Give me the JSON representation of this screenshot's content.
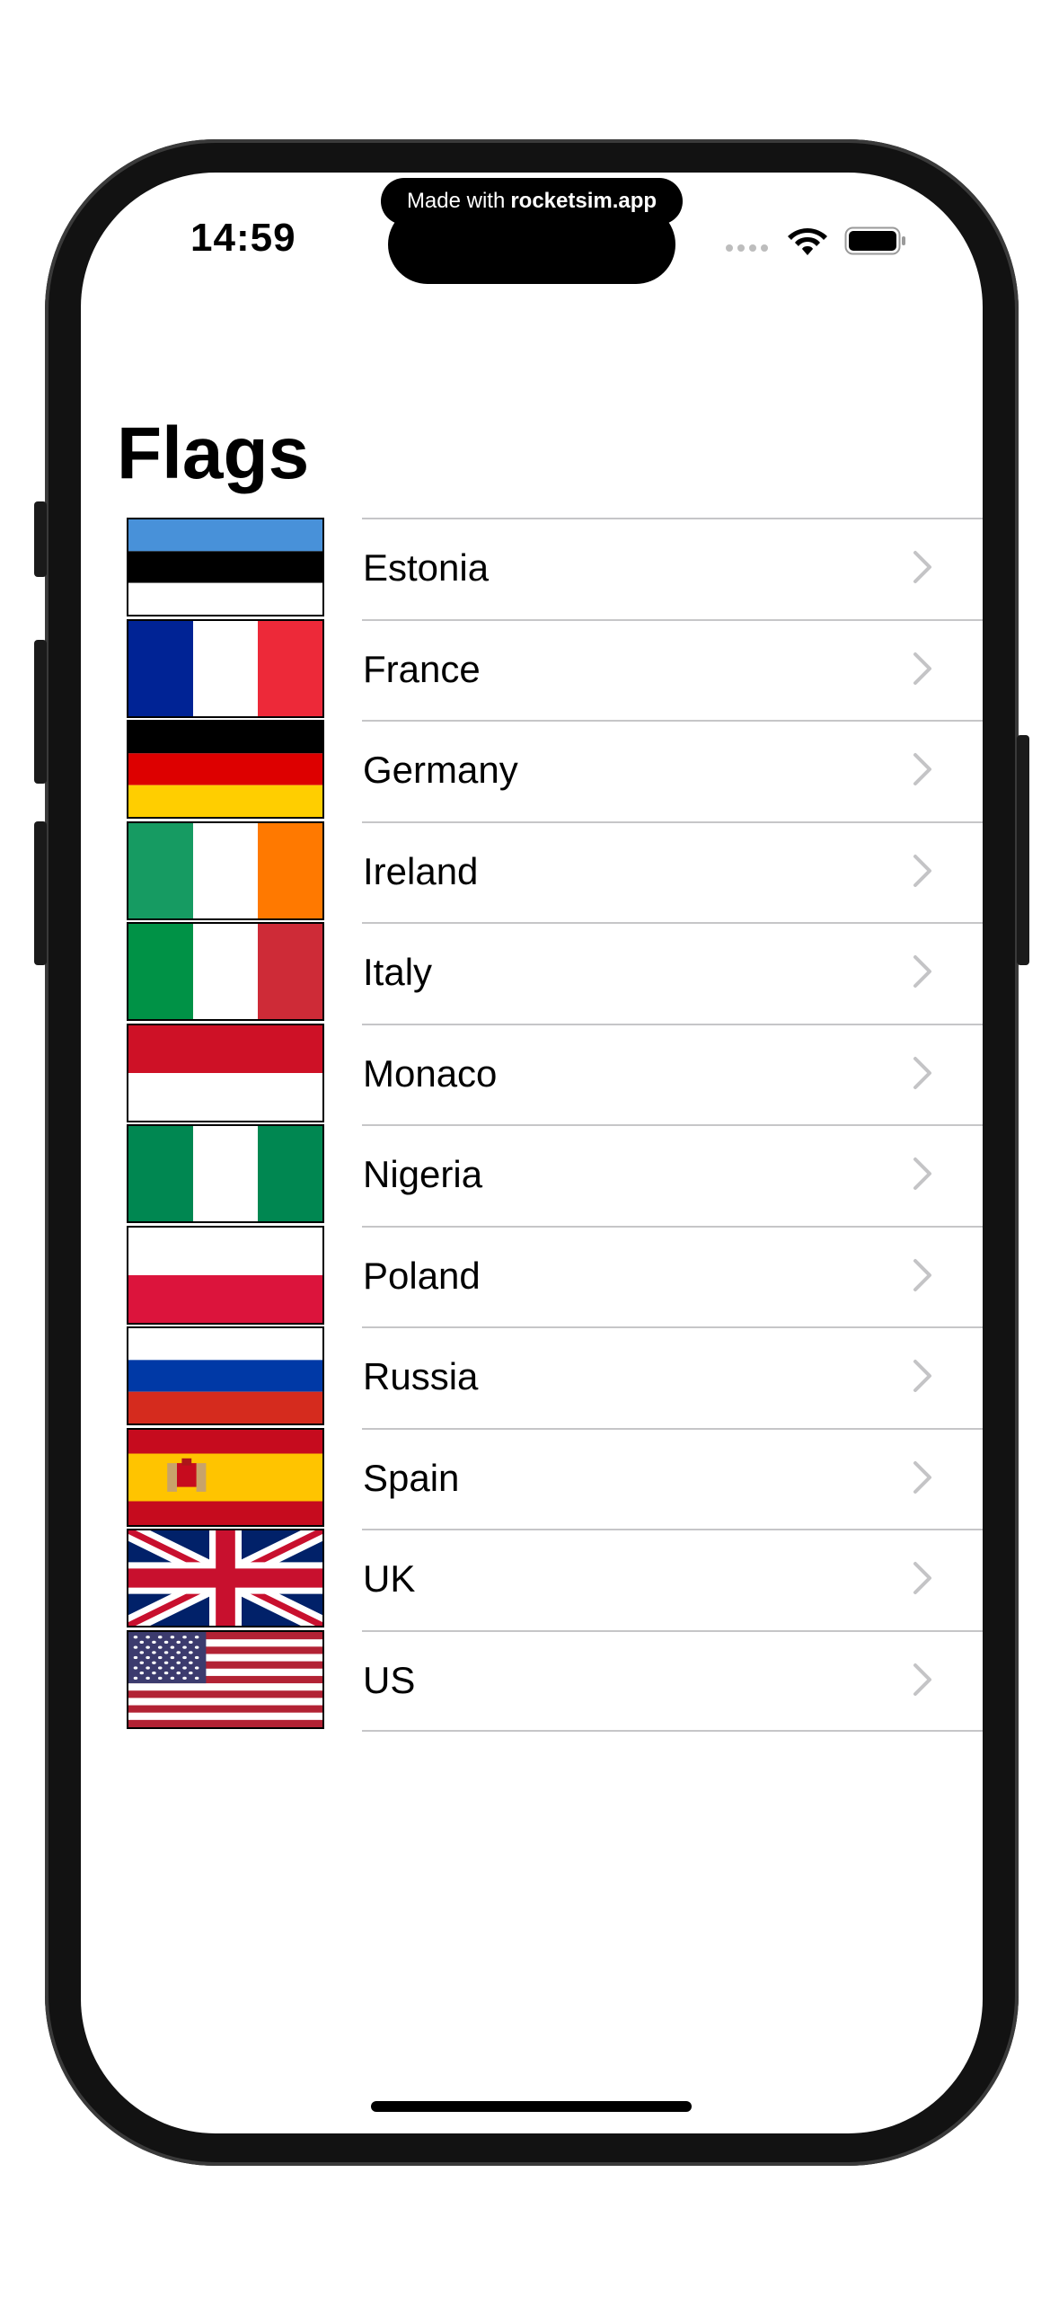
{
  "status_bar": {
    "time": "14:59",
    "badge_prefix": "Made with",
    "badge_brand": "rocketsim.app",
    "icons": [
      "cellular-dots-icon",
      "wifi-icon",
      "battery-icon"
    ]
  },
  "page": {
    "title": "Flags"
  },
  "countries": [
    {
      "name": "Estonia"
    },
    {
      "name": "France"
    },
    {
      "name": "Germany"
    },
    {
      "name": "Ireland"
    },
    {
      "name": "Italy"
    },
    {
      "name": "Monaco"
    },
    {
      "name": "Nigeria"
    },
    {
      "name": "Poland"
    },
    {
      "name": "Russia"
    },
    {
      "name": "Spain"
    },
    {
      "name": "UK"
    },
    {
      "name": "US"
    }
  ],
  "colors": {
    "separator": "#c6c6c8",
    "chevron": "#c4c4c6",
    "title": "#000000"
  }
}
